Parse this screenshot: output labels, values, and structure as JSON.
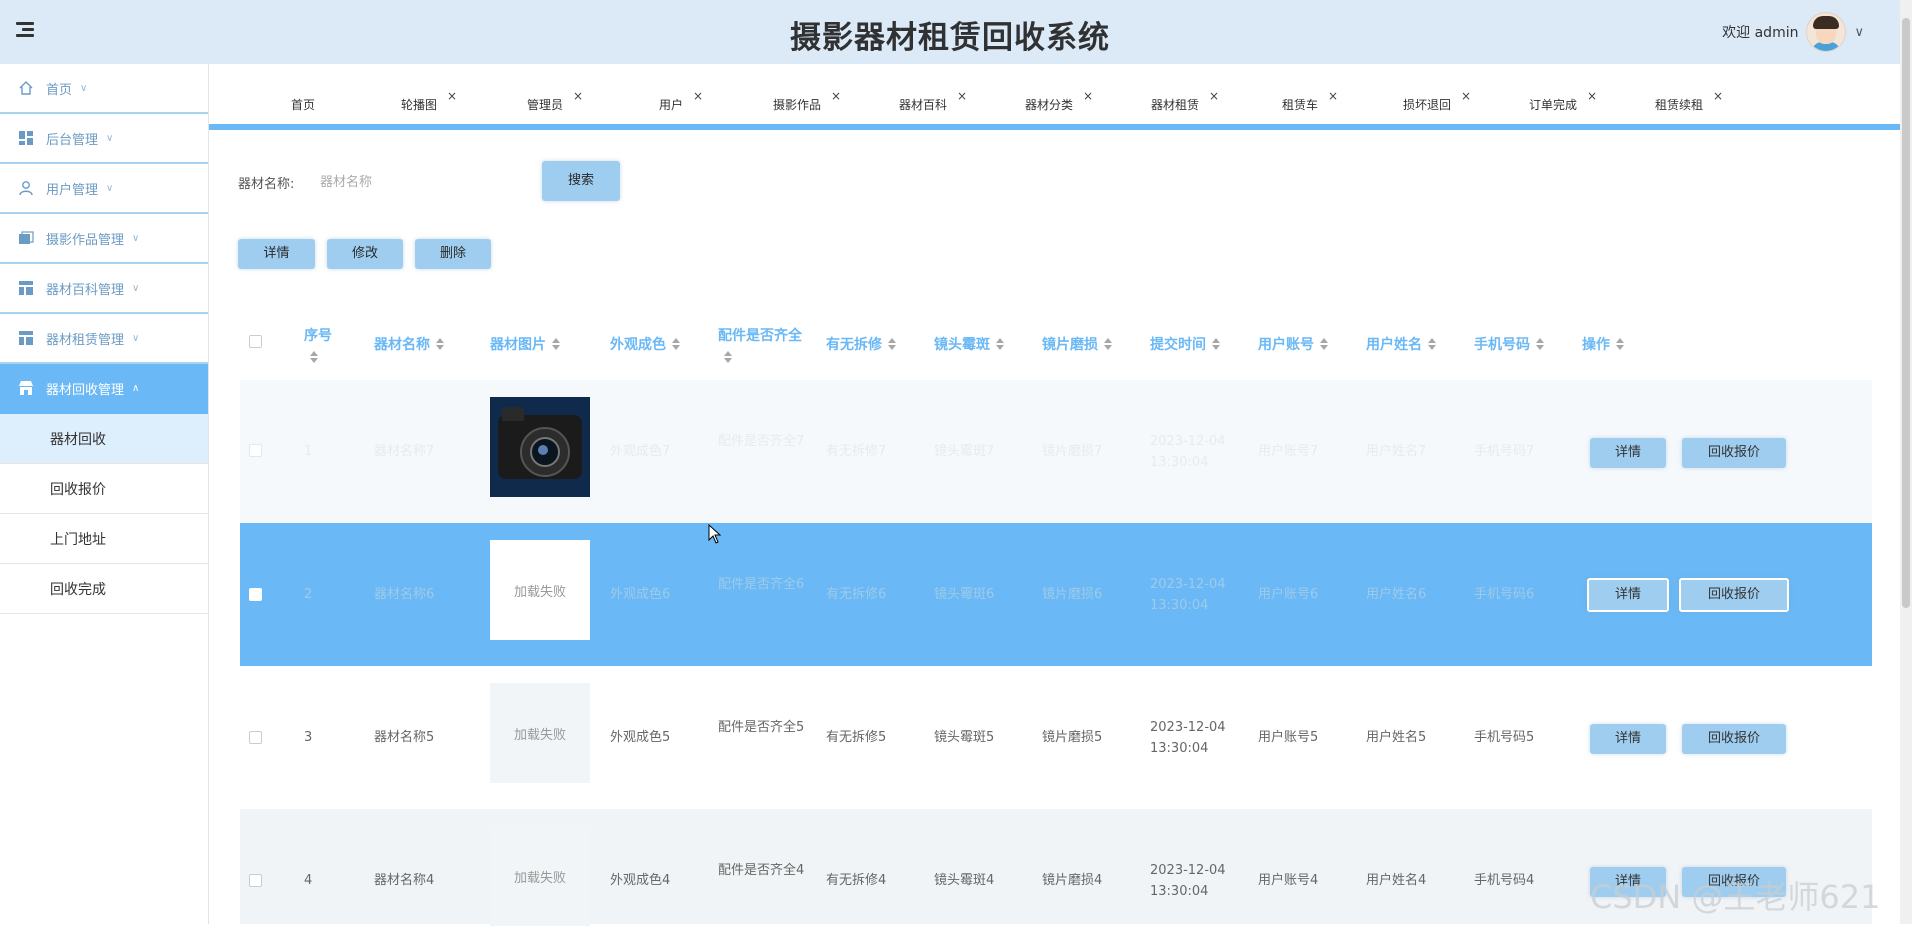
{
  "header": {
    "title": "摄影器材租赁回收系统",
    "welcome": "欢迎 admin"
  },
  "sidebar": {
    "items": [
      {
        "label": "首页",
        "caret": "∨"
      },
      {
        "label": "后台管理",
        "caret": "∨"
      },
      {
        "label": "用户管理",
        "caret": "∨"
      },
      {
        "label": "摄影作品管理",
        "caret": "∨"
      },
      {
        "label": "器材百科管理",
        "caret": "∨"
      },
      {
        "label": "器材租赁管理",
        "caret": "∨"
      },
      {
        "label": "器材回收管理",
        "caret": "∧"
      }
    ],
    "sub_items": [
      "器材回收",
      "回收报价",
      "上门地址",
      "回收完成"
    ]
  },
  "tabs": [
    "首页",
    "轮播图",
    "管理员",
    "用户",
    "摄影作品",
    "器材百科",
    "器材分类",
    "器材租赁",
    "租赁车",
    "损坏退回",
    "订单完成",
    "租赁续租"
  ],
  "search": {
    "label": "器材名称:",
    "placeholder": "器材名称",
    "button": "搜索"
  },
  "toolbar": {
    "detail": "详情",
    "edit": "修改",
    "delete": "删除"
  },
  "table": {
    "columns": [
      "序号",
      "器材名称",
      "器材图片",
      "外观成色",
      "配件是否齐全",
      "有无拆修",
      "镜头霉斑",
      "镜片磨损",
      "提交时间",
      "用户账号",
      "用户姓名",
      "手机号码",
      "操作"
    ],
    "rows": [
      {
        "index": "1",
        "name": "器材名称7",
        "image": "camera",
        "look": "外观成色7",
        "parts": "配件是否齐全7",
        "repair": "有无拆修7",
        "mold": "镜头霉斑7",
        "wear": "镜片磨损7",
        "time": "2023-12-04 13:30:04",
        "account": "用户账号7",
        "username": "用户姓名7",
        "phone": "手机号码7"
      },
      {
        "index": "2",
        "name": "器材名称6",
        "image": "加载失败",
        "look": "外观成色6",
        "parts": "配件是否齐全6",
        "repair": "有无拆修6",
        "mold": "镜头霉斑6",
        "wear": "镜片磨损6",
        "time": "2023-12-04 13:30:04",
        "account": "用户账号6",
        "username": "用户姓名6",
        "phone": "手机号码6"
      },
      {
        "index": "3",
        "name": "器材名称5",
        "image": "加载失败",
        "look": "外观成色5",
        "parts": "配件是否齐全5",
        "repair": "有无拆修5",
        "mold": "镜头霉斑5",
        "wear": "镜片磨损5",
        "time": "2023-12-04 13:30:04",
        "account": "用户账号5",
        "username": "用户姓名5",
        "phone": "手机号码5"
      },
      {
        "index": "4",
        "name": "器材名称4",
        "image": "加载失败",
        "look": "外观成色4",
        "parts": "配件是否齐全4",
        "repair": "有无拆修4",
        "mold": "镜头霉斑4",
        "wear": "镜片磨损4",
        "time": "2023-12-04 13:30:04",
        "account": "用户账号4",
        "username": "用户姓名4",
        "phone": "手机号码4"
      }
    ],
    "actions": {
      "detail": "详情",
      "quote": "回收报价"
    }
  },
  "watermark": "CSDN @王老师621",
  "colors": {
    "accent": "#6ab8f5",
    "header_bg": "#dce9f7",
    "button_bg": "#9fcdf0"
  }
}
